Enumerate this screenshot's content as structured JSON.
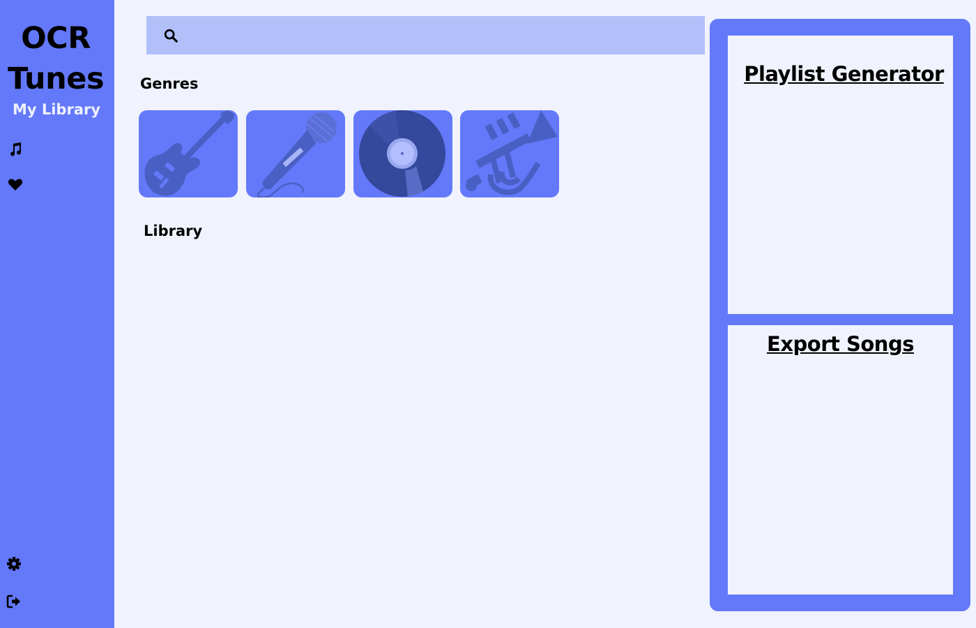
{
  "app": {
    "brand_line1": "OCR",
    "brand_line2": "Tunes",
    "subtitle": "My Library"
  },
  "sidebar": {
    "top_icons": [
      "music-note-icon",
      "heart-icon"
    ],
    "bottom_icons": [
      "gear-icon",
      "sign-out-icon"
    ]
  },
  "search": {
    "icon": "search-icon",
    "value": "",
    "placeholder": ""
  },
  "sections": {
    "genres": "Genres",
    "library": "Library"
  },
  "genres": [
    {
      "icon": "electric-guitar-icon"
    },
    {
      "icon": "microphone-icon"
    },
    {
      "icon": "vinyl-record-icon"
    },
    {
      "icon": "trumpet-icon"
    }
  ],
  "right_panel": {
    "playlist_title": "Playlist Generator",
    "export_title": "Export Songs"
  },
  "colors": {
    "accent": "#6479f9",
    "background": "#f0f3fd",
    "search_bg": "#b2c0fa",
    "icon_dark": "#3a4fa3"
  }
}
